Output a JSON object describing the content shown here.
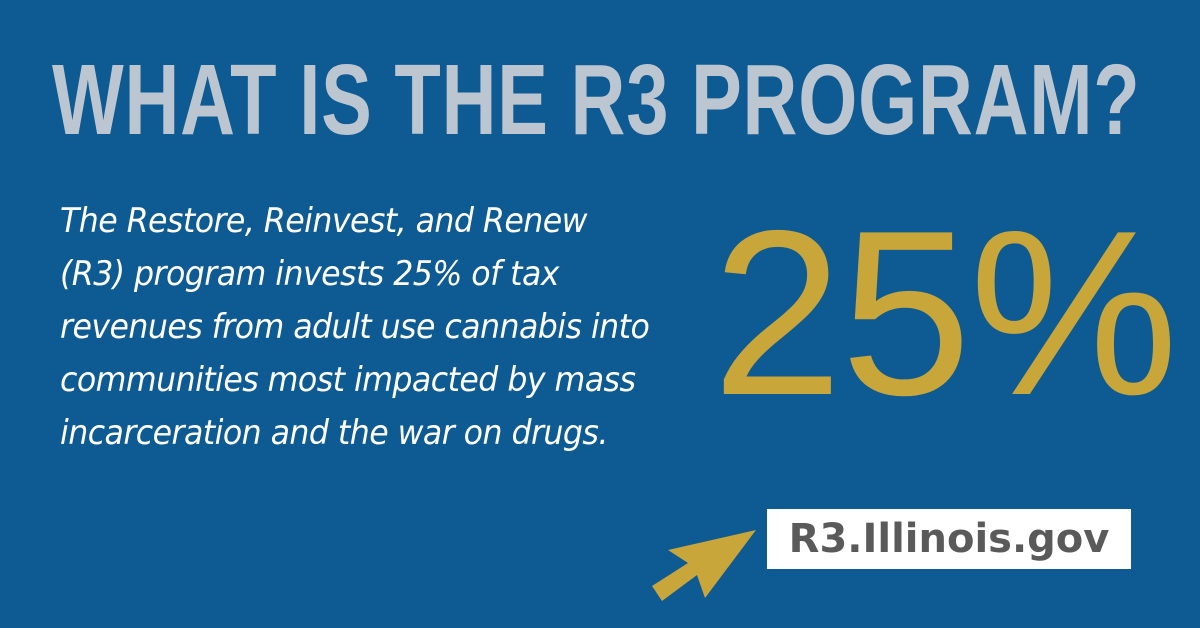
{
  "headline": "WHAT IS THE R3 PROGRAM?",
  "description": "The Restore, Reinvest, and Renew (R3) program invests 25% of tax revenues from adult use cannabis into communities most impacted by mass incarceration and the war on drugs.",
  "stat": "25%",
  "url": "R3.Illinois.gov",
  "colors": {
    "background": "#0e5a92",
    "headline": "#bcc6d0",
    "accent_gold": "#c8a63a",
    "body_text": "#ffffff",
    "url_text": "#5a5a5a",
    "url_box": "#ffffff"
  },
  "icons": {
    "pointer": "arrow-pointer-icon"
  }
}
